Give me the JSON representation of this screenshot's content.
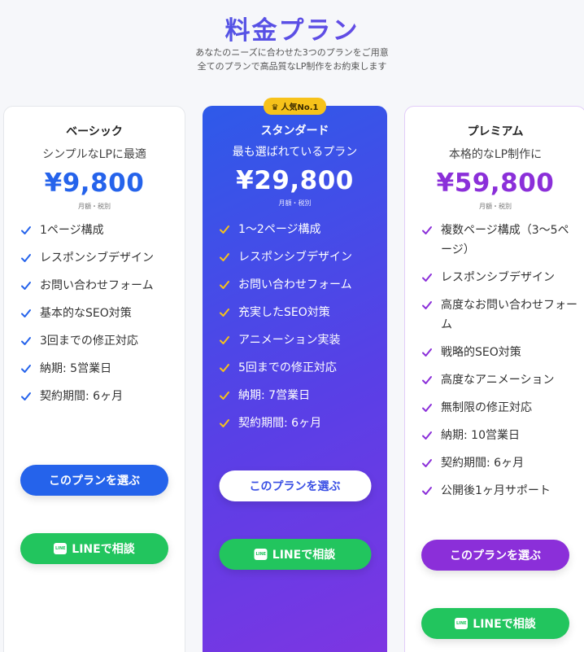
{
  "header": {
    "title": "料金プラン",
    "subtitle_line1": "あなたのニーズに合わせた3つのプランをご用意",
    "subtitle_line2": "全てのプランで高品質なLP制作をお約束します"
  },
  "colors": {
    "basic_accent": "#2563eb",
    "standard_gradient": [
      "#2e5ae9",
      "#7f35e2"
    ],
    "premium_accent": "#8b2fd9",
    "line_green": "#22c55e",
    "badge": "#f7c21a"
  },
  "plans": [
    {
      "name": "ベーシック",
      "description": "シンプルなLPに最適",
      "price": "¥9,800",
      "price_note": "月額・税別",
      "features": [
        "1ページ構成",
        "レスポンシブデザイン",
        "お問い合わせフォーム",
        "基本的なSEO対策",
        "3回までの修正対応",
        "納期: 5営業日",
        "契約期間: 6ヶ月"
      ],
      "select_button": "このプランを選ぶ",
      "line_button": "LINEで相談"
    },
    {
      "badge": "人気No.1",
      "name": "スタンダード",
      "description": "最も選ばれているプラン",
      "price": "¥29,800",
      "price_note": "月額・税別",
      "features": [
        "1〜2ページ構成",
        "レスポンシブデザイン",
        "お問い合わせフォーム",
        "充実したSEO対策",
        "アニメーション実装",
        "5回までの修正対応",
        "納期: 7営業日",
        "契約期間: 6ヶ月"
      ],
      "select_button": "このプランを選ぶ",
      "line_button": "LINEで相談"
    },
    {
      "name": "プレミアム",
      "description": "本格的なLP制作に",
      "price": "¥59,800",
      "price_note": "月額・税別",
      "features": [
        "複数ページ構成（3〜5ページ）",
        "レスポンシブデザイン",
        "高度なお問い合わせフォーム",
        "戦略的SEO対策",
        "高度なアニメーション",
        "無制限の修正対応",
        "納期: 10営業日",
        "契約期間: 6ヶ月",
        "公開後1ヶ月サポート"
      ],
      "select_button": "このプランを選ぶ",
      "line_button": "LINEで相談"
    }
  ],
  "icons": {
    "check": "check-icon",
    "crown": "crown-icon",
    "line": "line-icon"
  }
}
